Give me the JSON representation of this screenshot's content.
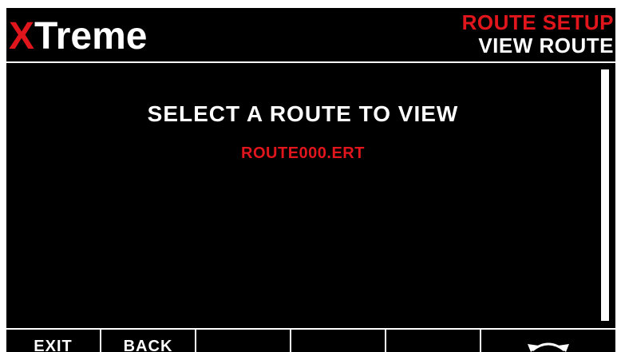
{
  "header": {
    "brand_x": "X",
    "brand_rest": "Treme",
    "mode_title": "ROUTE SETUP",
    "screen_title": "VIEW ROUTE"
  },
  "main": {
    "prompt": "SELECT A ROUTE TO VIEW",
    "routes": [
      "ROUTE000.ERT"
    ],
    "selected_index": 0
  },
  "softkeys": [
    {
      "label": "EXIT"
    },
    {
      "label": "BACK"
    },
    {
      "label": ""
    },
    {
      "label": ""
    },
    {
      "label": ""
    },
    {
      "label": "",
      "icon": "rotate-arrows-icon"
    }
  ],
  "colors": {
    "accent_red": "#e0161c",
    "text": "#ffffff",
    "background": "#000000"
  }
}
